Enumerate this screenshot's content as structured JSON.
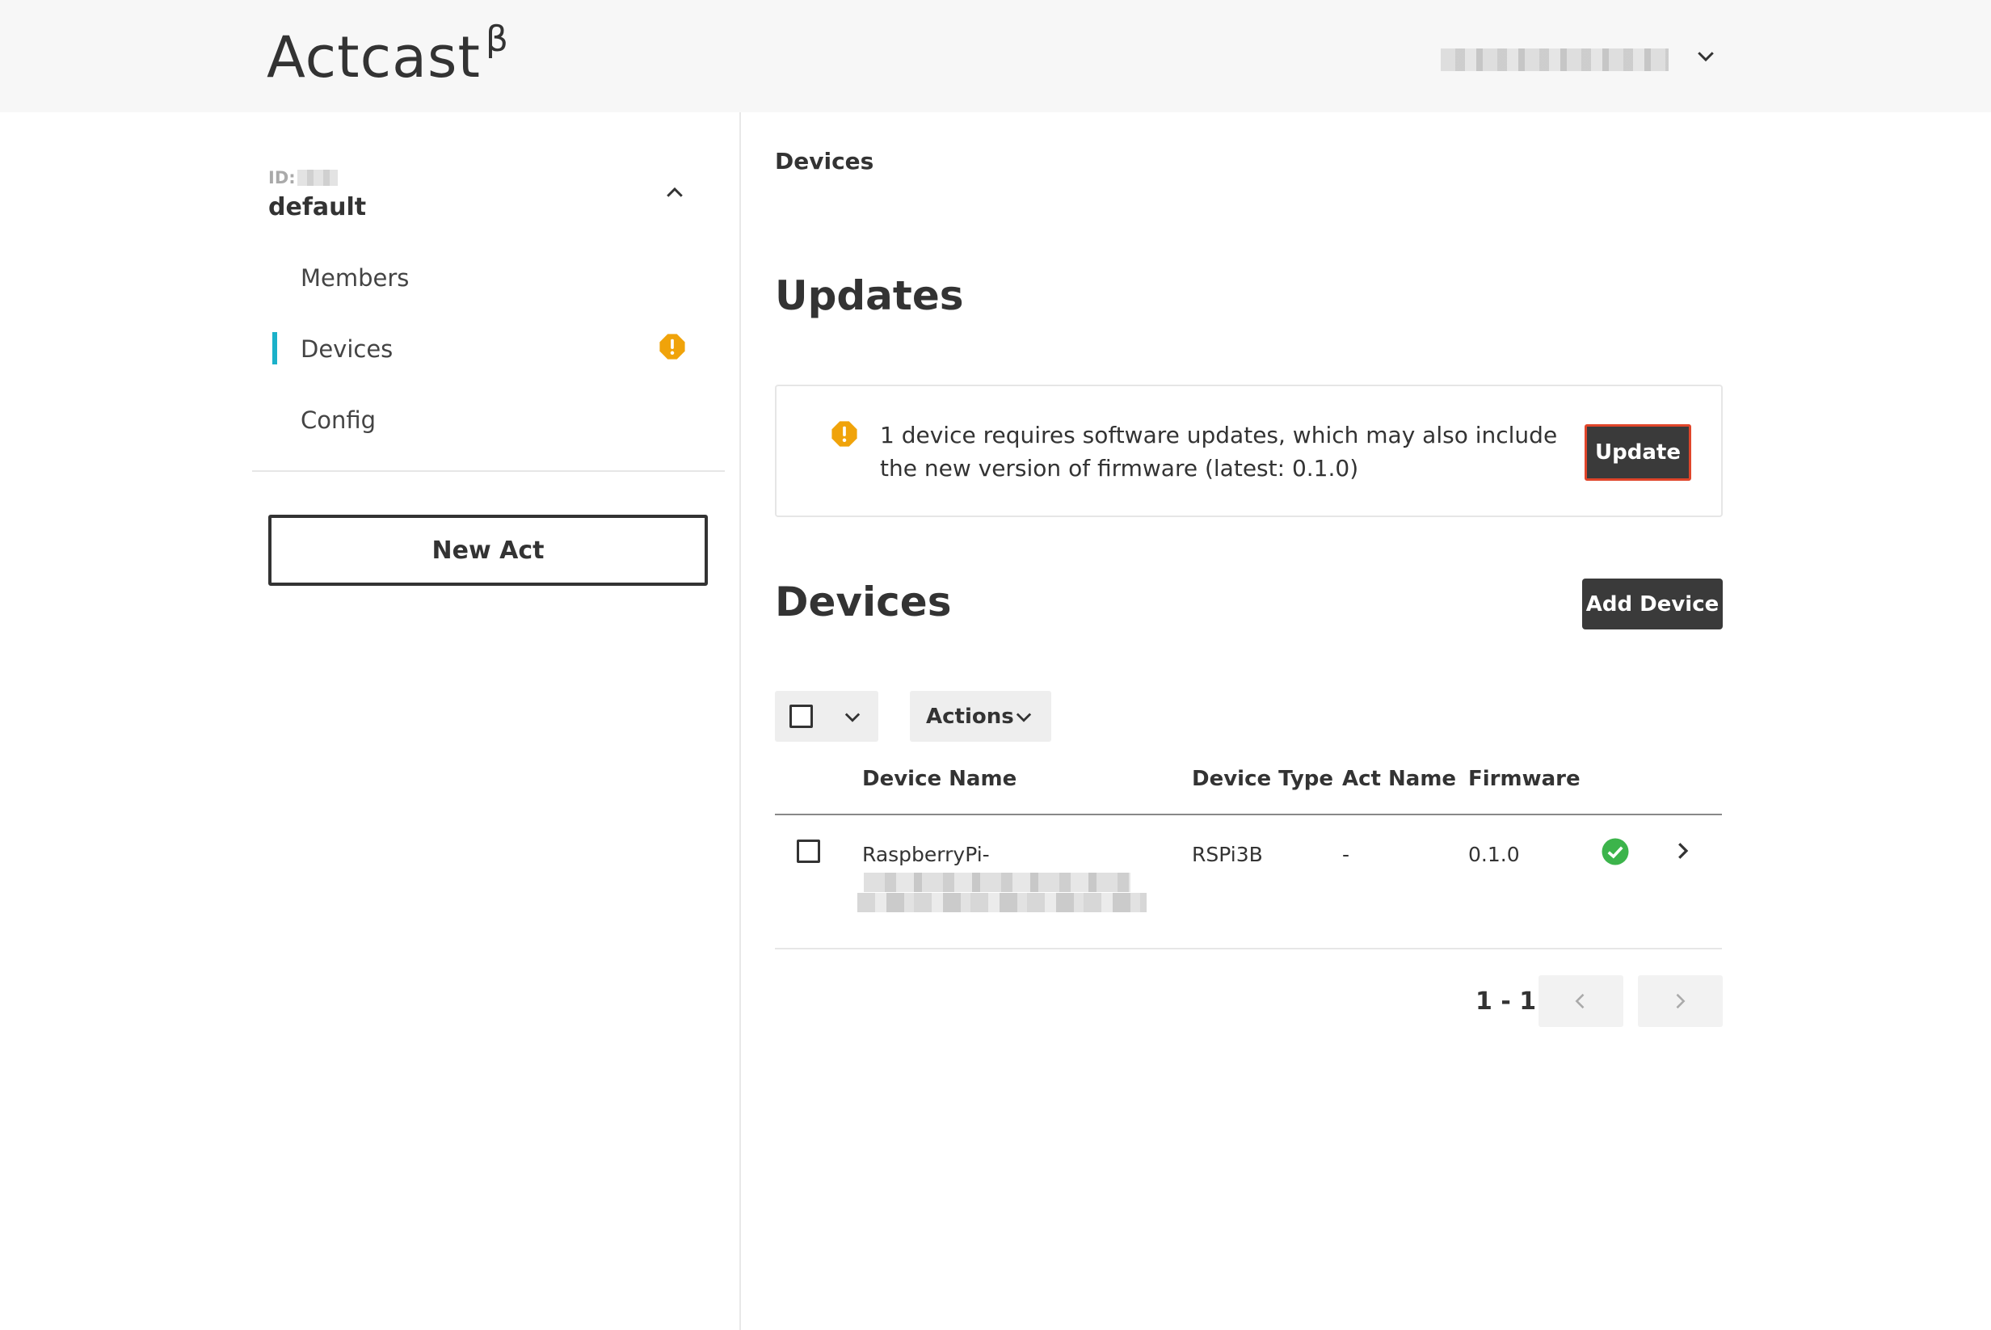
{
  "header": {
    "logo_text": "Actcast",
    "logo_suffix": "β"
  },
  "sidebar": {
    "group_id_label": "ID:",
    "group_name": "default",
    "items": [
      {
        "label": "Members",
        "active": false
      },
      {
        "label": "Devices",
        "active": true,
        "has_warning": true
      },
      {
        "label": "Config",
        "active": false
      }
    ],
    "new_act_label": "New Act"
  },
  "main": {
    "breadcrumb": "Devices",
    "updates_heading": "Updates",
    "update_message": "1 device requires software updates, which may also include the new version of firmware (latest: 0.1.0)",
    "update_button": "Update",
    "devices_heading": "Devices",
    "add_device_button": "Add Device",
    "actions_label": "Actions",
    "table": {
      "columns": [
        "Device Name",
        "Device Type",
        "Act Name",
        "Firmware"
      ],
      "rows": [
        {
          "device_name": "RaspberryPi-",
          "device_type": "RSPi3B",
          "act_name": "-",
          "firmware": "0.1.0",
          "status": "ok"
        }
      ]
    },
    "pagination": {
      "range": "1 - 1"
    }
  },
  "colors": {
    "accent": "#1bb1c9",
    "warning": "#f0a30a",
    "success": "#3cb44b",
    "dark_button": "#3a3a3a",
    "highlight_border": "#e0452a"
  }
}
